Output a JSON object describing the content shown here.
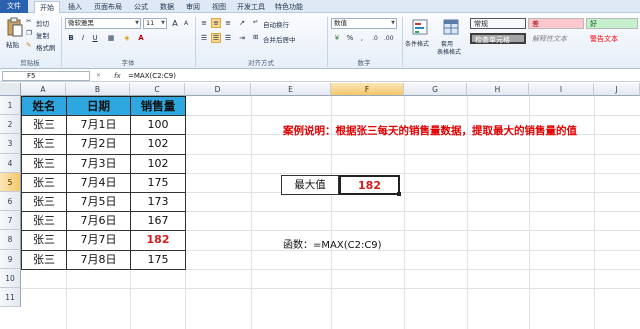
{
  "ribbon": {
    "tabs": [
      "文件",
      "开始",
      "插入",
      "页面布局",
      "公式",
      "数据",
      "审阅",
      "视图",
      "开发工具",
      "特色功能"
    ],
    "clipboard": {
      "paste": "粘贴",
      "cut": "剪切",
      "copy": "复制",
      "format_painter": "格式刷",
      "group": "剪贴板"
    },
    "font": {
      "name": "微软雅黑",
      "size": "11",
      "group": "字体"
    },
    "alignment": {
      "wrap": "自动换行",
      "merge": "合并后居中",
      "group": "对齐方式"
    },
    "number": {
      "format": "数值",
      "group": "数字"
    },
    "styles": {
      "conditional": "条件格式",
      "table_format": "套用\n表格格式",
      "cells": [
        {
          "label": "常规",
          "bg": "#ffffff",
          "fg": "#222222"
        },
        {
          "label": "差",
          "bg": "#ffc7ce",
          "fg": "#9c0006"
        },
        {
          "label": "好",
          "bg": "#c6efce",
          "fg": "#006100"
        },
        {
          "label": "检查单元格",
          "bg": "#a5a5a5",
          "fg": "#ffffff"
        },
        {
          "label": "解释性文本",
          "bg": "#ffffff",
          "fg": "#7f7f7f"
        },
        {
          "label": "警告文本",
          "bg": "#ffffff",
          "fg": "#ff0000"
        }
      ]
    }
  },
  "formula_bar": {
    "name_box": "F5",
    "fx": "fx",
    "formula": "=MAX(C2:C9)"
  },
  "sheet": {
    "columns": [
      "A",
      "B",
      "C",
      "D",
      "E",
      "F",
      "G",
      "H",
      "I",
      "J"
    ],
    "rows": [
      "1",
      "2",
      "3",
      "4",
      "5",
      "6",
      "7",
      "8",
      "9",
      "10",
      "11"
    ],
    "table": {
      "headers": [
        "姓名",
        "日期",
        "销售量"
      ],
      "rows": [
        [
          "张三",
          "7月1日",
          "100"
        ],
        [
          "张三",
          "7月2日",
          "102"
        ],
        [
          "张三",
          "7月3日",
          "102"
        ],
        [
          "张三",
          "7月4日",
          "175"
        ],
        [
          "张三",
          "7月5日",
          "173"
        ],
        [
          "张三",
          "7月6日",
          "167"
        ],
        [
          "张三",
          "7月7日",
          "182"
        ],
        [
          "张三",
          "7月8日",
          "175"
        ]
      ],
      "highlight_row": 6
    },
    "note": "案例说明：根据张三每天的销售量数据，提取最大的销售量的值",
    "max_label": "最大值",
    "max_value": "182",
    "formula_text": "函数：=MAX(C2:C9)"
  },
  "colors": {
    "header_fill": "#2ea7e0",
    "accent_red": "#d21d1d",
    "file_tab": "#2a62b0"
  }
}
